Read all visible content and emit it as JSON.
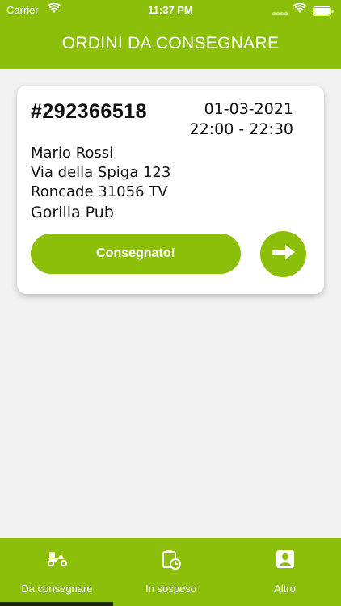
{
  "status_bar": {
    "carrier": "Carrier",
    "time": "11:37 PM"
  },
  "header": {
    "title": "ORDINI DA CONSEGNARE"
  },
  "orders": [
    {
      "number": "#292366518",
      "date": "01-03-2021",
      "time_range": "22:00 - 22:30",
      "customer_name": "Mario Rossi",
      "address_line1": "Via della Spiga 123",
      "address_line2": "Roncade 31056 TV",
      "venue": "Gorilla Pub",
      "confirm_label": "Consegnato!",
      "next_icon": "arrow-right-icon"
    }
  ],
  "tabbar": {
    "tabs": [
      {
        "label": "Da consegnare",
        "icon": "scooter-icon"
      },
      {
        "label": "In sospeso",
        "icon": "clipboard-clock-icon"
      },
      {
        "label": "Altro",
        "icon": "user-badge-icon"
      }
    ]
  },
  "colors": {
    "brand": "#8cbf0a",
    "background": "#f2f2f2"
  }
}
